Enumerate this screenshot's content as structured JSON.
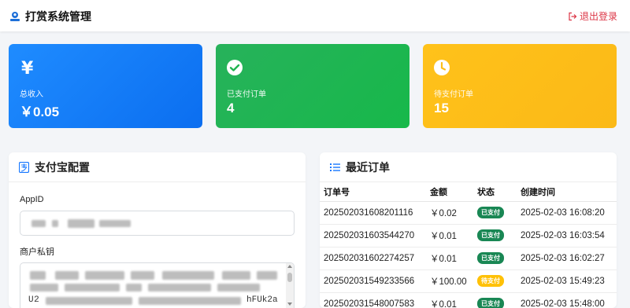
{
  "navbar": {
    "title": "打赏系统管理",
    "logout_label": "退出登录"
  },
  "stats": [
    {
      "icon": "yen-icon",
      "label": "总收入",
      "value": "￥0.05",
      "color": "#1a84fb"
    },
    {
      "icon": "check-circle-icon",
      "label": "已支付订单",
      "value": "4",
      "color": "#20b450"
    },
    {
      "icon": "clock-icon",
      "label": "待支付订单",
      "value": "15",
      "color": "#fdbf1a"
    }
  ],
  "alipay": {
    "title": "支付宝配置",
    "appid_label": "AppID",
    "private_key_label": "商户私钥",
    "private_key_visible_start": "U2",
    "private_key_visible_end": "hFUk2a"
  },
  "orders": {
    "title": "最近订单",
    "columns": [
      "订单号",
      "金额",
      "状态",
      "创建时间"
    ],
    "rows": [
      {
        "id": "202502031608201116",
        "amount": "￥0.02",
        "status": "已支付",
        "paid": true,
        "time": "2025-02-03 16:08:20"
      },
      {
        "id": "202502031603544270",
        "amount": "￥0.01",
        "status": "已支付",
        "paid": true,
        "time": "2025-02-03 16:03:54"
      },
      {
        "id": "202502031602274257",
        "amount": "￥0.01",
        "status": "已支付",
        "paid": true,
        "time": "2025-02-03 16:02:27"
      },
      {
        "id": "202502031549233566",
        "amount": "￥100.00",
        "status": "待支付",
        "paid": false,
        "time": "2025-02-03 15:49:23"
      },
      {
        "id": "202502031548007583",
        "amount": "￥0.01",
        "status": "已支付",
        "paid": true,
        "time": "2025-02-03 15:48:00"
      }
    ]
  }
}
